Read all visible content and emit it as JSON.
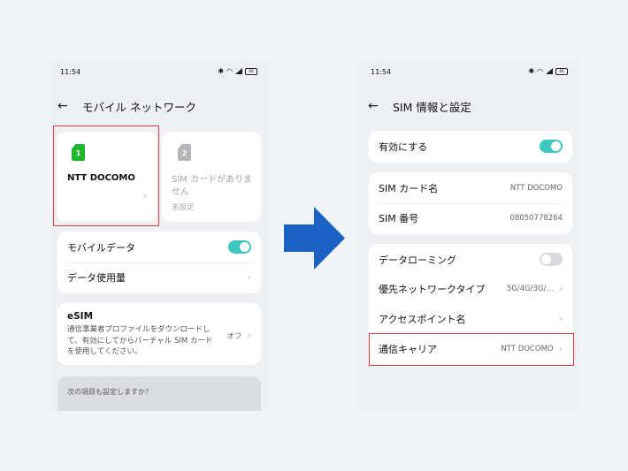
{
  "left": {
    "status": {
      "time": "11:54",
      "battery": "60"
    },
    "header": {
      "title": "モバイル ネットワーク"
    },
    "sim1": {
      "badge": "1",
      "name": "NTT DOCOMO",
      "color": "#1fb72b"
    },
    "sim2": {
      "badge": "2",
      "text": "SIM カードがありません",
      "sub": "未設定",
      "color": "#b5b5ba"
    },
    "rows": {
      "mobile_data": "モバイルデータ",
      "data_usage": "データ使用量"
    },
    "esim": {
      "title": "eSIM",
      "desc": "通信事業者プロファイルをダウンロードして、有効にしてからバーチャル SIM カードを使用してください。",
      "value": "オフ"
    },
    "suggest": {
      "label": "次の項目も設定しますか？"
    }
  },
  "right": {
    "status": {
      "time": "11:54",
      "battery": "60"
    },
    "header": {
      "title": "SIM 情報と設定"
    },
    "enable": {
      "label": "有効にする"
    },
    "sim_name": {
      "label": "SIM カード名",
      "value": "NTT DOCOMO"
    },
    "sim_number": {
      "label": "SIM 番号",
      "value": "08050778264"
    },
    "roaming": {
      "label": "データローミング"
    },
    "network_type": {
      "label": "優先ネットワークタイプ",
      "value": "5G/4G/3G/..."
    },
    "apn": {
      "label": "アクセスポイント名"
    },
    "carrier": {
      "label": "通信キャリア",
      "value": "NTT DOCOMO"
    }
  },
  "colors": {
    "accent": "#3ec6c1",
    "highlight": "#e23a3a",
    "arrow": "#1a63c4"
  }
}
